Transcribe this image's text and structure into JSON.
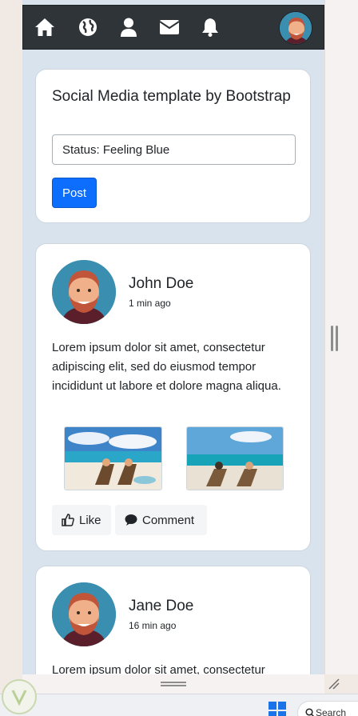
{
  "navbar": {
    "icons": [
      "home-icon",
      "globe-icon",
      "user-icon",
      "envelope-icon",
      "bell-icon"
    ],
    "background": "#2f3438"
  },
  "composer": {
    "title": "Social Media template by Bootstrap",
    "status_value": "Status: Feeling Blue",
    "post_label": "Post"
  },
  "posts": [
    {
      "name": "John Doe",
      "time": "1 min ago",
      "text": "Lorem ipsum dolor sit amet, consectetur adipiscing elit, sed do eiusmod tempor incididunt ut labore et dolore magna aliqua.",
      "like_label": "Like",
      "comment_label": "Comment"
    },
    {
      "name": "Jane Doe",
      "time": "16 min ago",
      "text": "Lorem ipsum dolor sit amet, consectetur"
    }
  ],
  "taskbar": {
    "search_label": "Search"
  },
  "colors": {
    "accent": "#0d6efd",
    "page_background": "#d8e3ee"
  }
}
